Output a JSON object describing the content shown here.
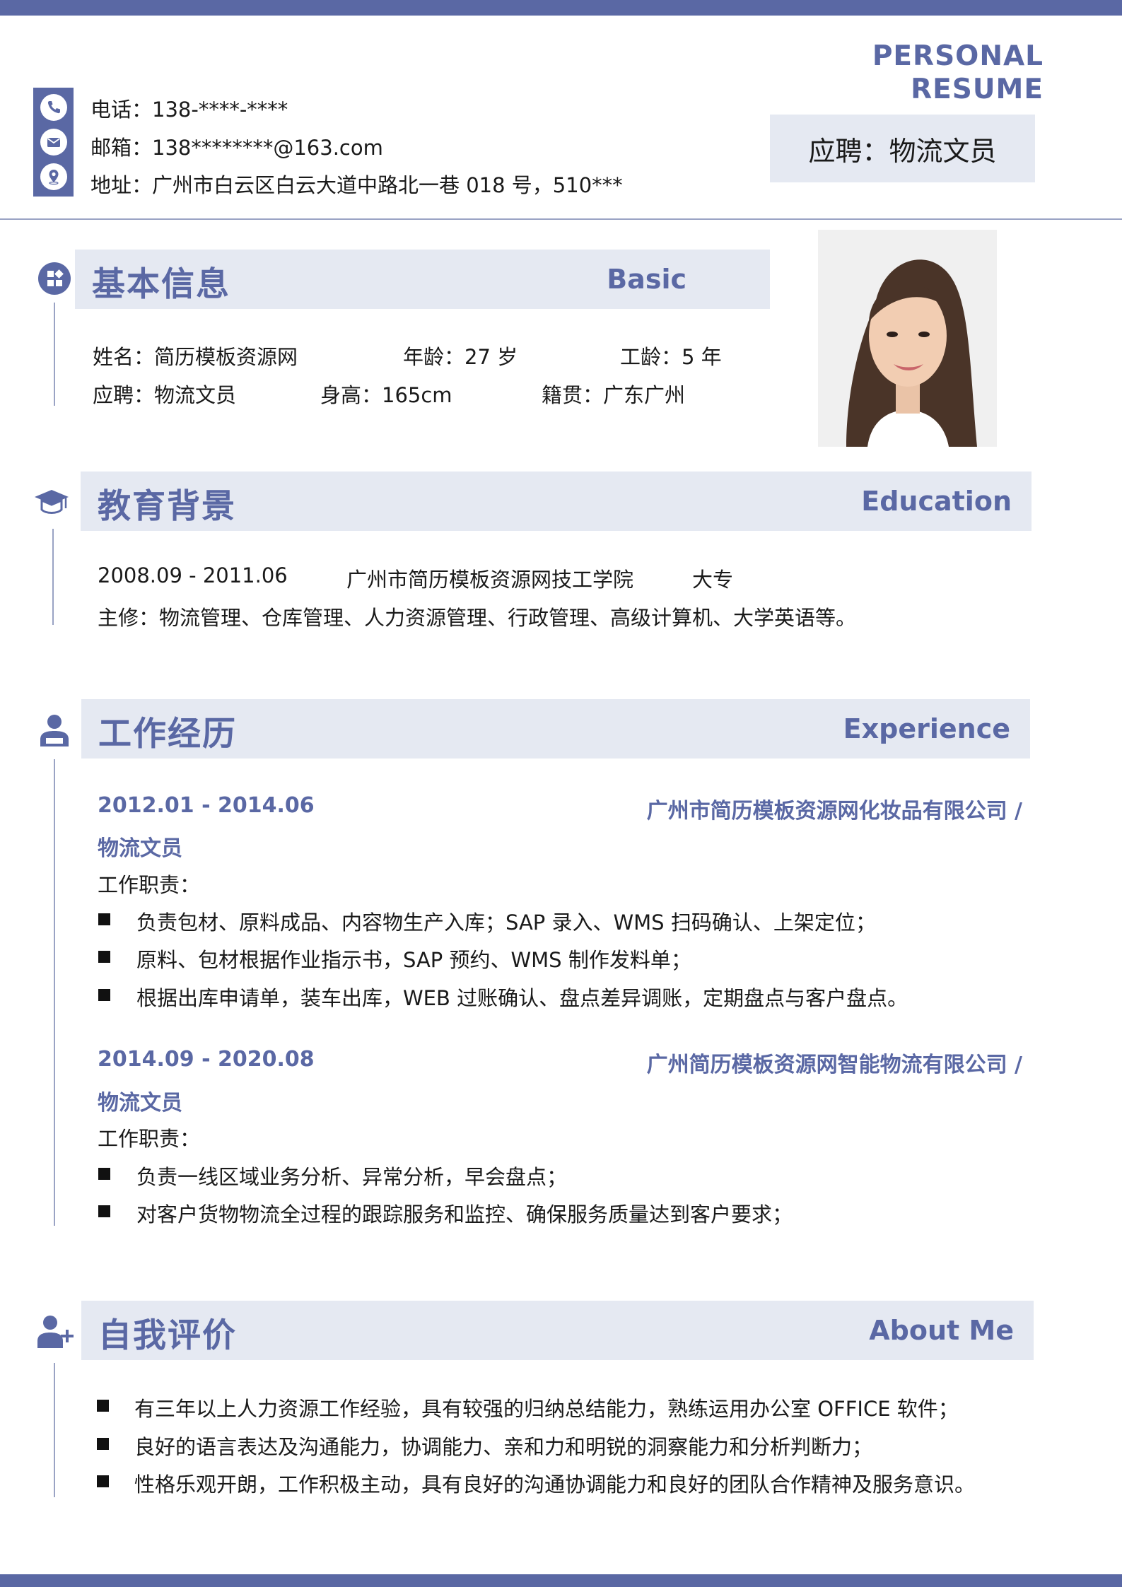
{
  "header": {
    "title": "PERSONAL　RESUME",
    "contacts": {
      "phone": "电话：138-****-****",
      "email": "邮箱：138********@163.com",
      "address": "地址：广州市白云区白云大道中路北一巷 018 号，510***"
    },
    "apply": "应聘：物流文员"
  },
  "basic": {
    "title_cn": "基本信息",
    "title_en": "Basic",
    "name": "姓名：简历模板资源网",
    "age": "年龄：27 岁",
    "work_years": "工龄：5 年",
    "position": "应聘：物流文员",
    "height": "身高：165cm",
    "origin": "籍贯：广东广州"
  },
  "education": {
    "title_cn": "教育背景",
    "title_en": "Education",
    "period": "2008.09 - 2011.06",
    "school": "广州市简历模板资源网技工学院",
    "degree": "大专",
    "major": "主修：物流管理、仓库管理、人力资源管理、行政管理、高级计算机、大学英语等。"
  },
  "experience": {
    "title_cn": "工作经历",
    "title_en": "Experience",
    "jobs": [
      {
        "period": "2012.01 - 2014.06",
        "company": "广州市简历模板资源网化妆品有限公司 /",
        "role": "物流文员",
        "duty_label": "工作职责：",
        "duties": [
          "负责包材、原料成品、内容物生产入库；SAP 录入、WMS 扫码确认、上架定位；",
          "原料、包材根据作业指示书，SAP 预约、WMS 制作发料单；",
          "根据出库申请单，装车出库，WEB 过账确认、盘点差异调账，定期盘点与客户盘点。"
        ]
      },
      {
        "period": "2014.09 - 2020.08",
        "company": "广州简历模板资源网智能物流有限公司 /",
        "role": "物流文员",
        "duty_label": "工作职责：",
        "duties": [
          "负责一线区域业务分析、异常分析，早会盘点；",
          "对客户货物物流全过程的跟踪服务和监控、确保服务质量达到客户要求；"
        ]
      }
    ]
  },
  "about": {
    "title_cn": "自我评价",
    "title_en": "About Me",
    "items": [
      "有三年以上人力资源工作经验，具有较强的归纳总结能力，熟练运用办公室 OFFICE 软件；",
      "良好的语言表达及沟通能力，协调能力、亲和力和明锐的洞察能力和分析判断力；",
      "性格乐观开朗，工作积极主动，具有良好的沟通协调能力和良好的团队合作精神及服务意识。"
    ]
  },
  "colors": {
    "accent": "#5a68a4",
    "band": "#e5e9f2",
    "rule": "#9aa3c4"
  }
}
